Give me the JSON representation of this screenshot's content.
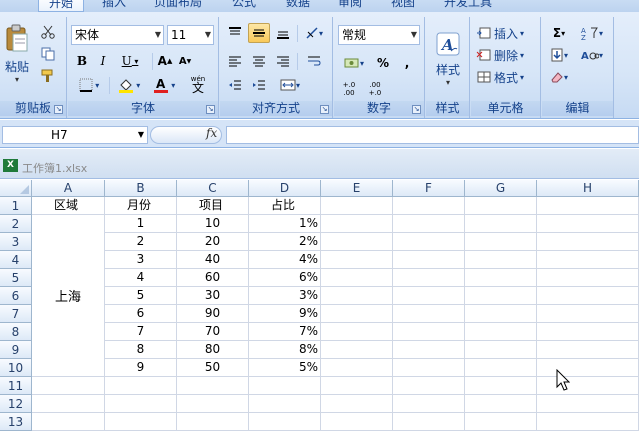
{
  "ribbon_tabs": [
    "开始",
    "插入",
    "页面布局",
    "公式",
    "数据",
    "审阅",
    "视图",
    "开发工具"
  ],
  "active_tab": "开始",
  "groups": {
    "clipboard": {
      "label": "剪贴板",
      "paste_label": "粘贴"
    },
    "font": {
      "label": "字体",
      "font_name": "宋体",
      "font_size": "11",
      "wen_label": "wén",
      "wen_char": "文"
    },
    "alignment": {
      "label": "对齐方式"
    },
    "number": {
      "label": "数字",
      "format": "常规",
      "percent": "%",
      "comma": ",",
      "dec_inc": "+.0 .00",
      "dec_dec": ".00 +.0"
    },
    "styles": {
      "label": "样式"
    },
    "cells": {
      "label": "单元格",
      "insert": "插入",
      "delete": "删除",
      "format": "格式"
    },
    "editing": {
      "label": "编辑"
    }
  },
  "formula_bar": {
    "name_box": "H7",
    "fx_label": "fx",
    "formula": ""
  },
  "workbook": {
    "title": "工作簿1.xlsx"
  },
  "columns": [
    "A",
    "B",
    "C",
    "D",
    "E",
    "F",
    "G",
    "H"
  ],
  "rows": [
    "1",
    "2",
    "3",
    "4",
    "5",
    "6",
    "7",
    "8",
    "9",
    "10",
    "11",
    "12",
    "13"
  ],
  "table": {
    "headers": [
      "区域",
      "月份",
      "项目",
      "占比"
    ],
    "region": "上海",
    "data": [
      [
        "1",
        "10",
        "1%"
      ],
      [
        "2",
        "20",
        "2%"
      ],
      [
        "3",
        "40",
        "4%"
      ],
      [
        "4",
        "60",
        "6%"
      ],
      [
        "5",
        "30",
        "3%"
      ],
      [
        "6",
        "90",
        "9%"
      ],
      [
        "7",
        "70",
        "7%"
      ],
      [
        "8",
        "80",
        "8%"
      ],
      [
        "9",
        "50",
        "5%"
      ]
    ]
  },
  "colors": {
    "ribbon": "#d6e5f7",
    "header_text": "#15428b",
    "grid_line": "#d0d7e5",
    "font_red": "#e02020",
    "highlight_yellow": "#ffe400"
  }
}
